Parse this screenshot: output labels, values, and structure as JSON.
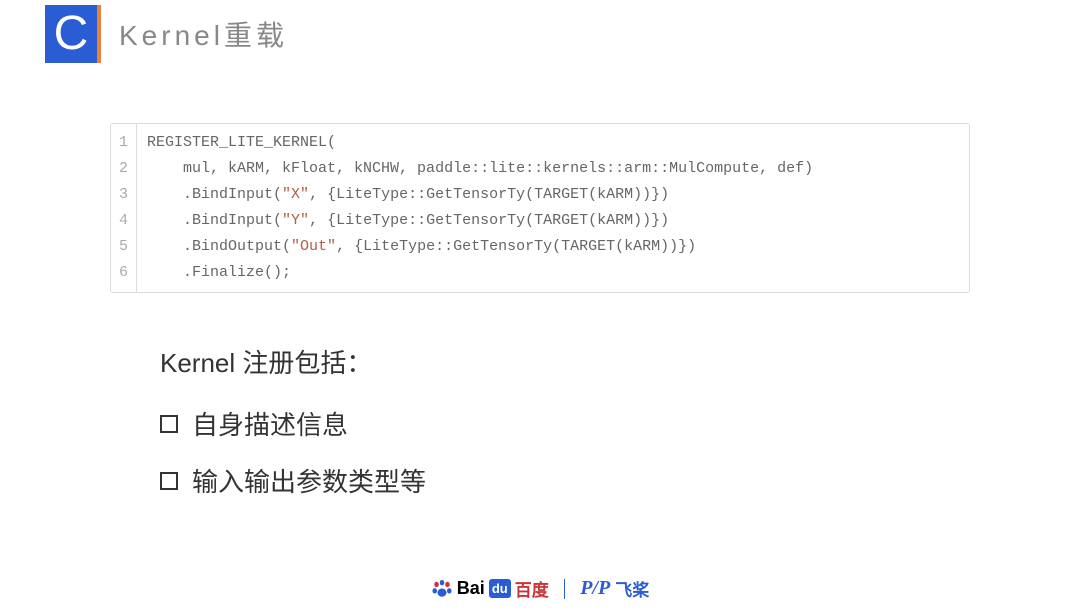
{
  "header": {
    "letter": "C",
    "title": "Kernel重载"
  },
  "code": {
    "lines": [
      "1",
      "2",
      "3",
      "4",
      "5",
      "6"
    ],
    "l1": "REGISTER_LITE_KERNEL(",
    "l2a": "    mul, kARM, kFloat, kNCHW, paddle::lite::kernels::arm::MulCompute, def)",
    "l3a": "    .BindInput(",
    "l3s": "\"X\"",
    "l3b": ", {LiteType::GetTensorTy(TARGET(kARM))})",
    "l4a": "    .BindInput(",
    "l4s": "\"Y\"",
    "l4b": ", {LiteType::GetTensorTy(TARGET(kARM))})",
    "l5a": "    .BindOutput(",
    "l5s": "\"Out\"",
    "l5b": ", {LiteType::GetTensorTy(TARGET(kARM))})",
    "l6": "    .Finalize();"
  },
  "text": {
    "heading": "Kernel 注册包括：",
    "bullet1": "自身描述信息",
    "bullet2": "输入输出参数类型等"
  },
  "footer": {
    "bai": "Bai",
    "du": "du",
    "baidu_cn": "百度",
    "paddle_script": "P/P",
    "paddle_cn": "飞桨"
  }
}
